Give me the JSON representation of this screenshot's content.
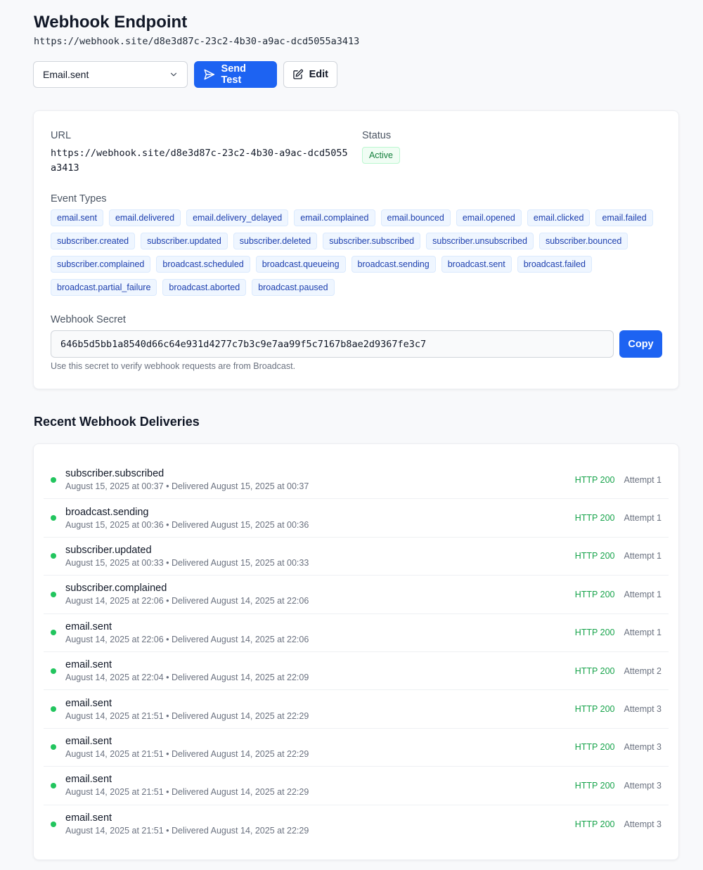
{
  "header": {
    "title": "Webhook Endpoint",
    "url": "https://webhook.site/d8e3d87c-23c2-4b30-a9ac-dcd5055a3413"
  },
  "toolbar": {
    "selected_event": "Email.sent",
    "send_test_label": "Send Test",
    "edit_label": "Edit"
  },
  "details": {
    "url_label": "URL",
    "url_value": "https://webhook.site/d8e3d87c-23c2-4b30-a9ac-dcd5055a3413",
    "status_label": "Status",
    "status_value": "Active",
    "event_types_label": "Event Types",
    "event_types": [
      "email.sent",
      "email.delivered",
      "email.delivery_delayed",
      "email.complained",
      "email.bounced",
      "email.opened",
      "email.clicked",
      "email.failed",
      "subscriber.created",
      "subscriber.updated",
      "subscriber.deleted",
      "subscriber.subscribed",
      "subscriber.unsubscribed",
      "subscriber.bounced",
      "subscriber.complained",
      "broadcast.scheduled",
      "broadcast.queueing",
      "broadcast.sending",
      "broadcast.sent",
      "broadcast.failed",
      "broadcast.partial_failure",
      "broadcast.aborted",
      "broadcast.paused"
    ],
    "secret_label": "Webhook Secret",
    "secret_value": "646b5d5bb1a8540d66c64e931d4277c7b3c9e7aa99f5c7167b8ae2d9367fe3c7",
    "copy_label": "Copy",
    "secret_help": "Use this secret to verify webhook requests are from Broadcast."
  },
  "deliveries": {
    "title": "Recent Webhook Deliveries",
    "items": [
      {
        "event": "subscriber.subscribed",
        "meta": "August 15, 2025 at 00:37 • Delivered August 15, 2025 at 00:37",
        "http": "HTTP 200",
        "attempt": "Attempt 1"
      },
      {
        "event": "broadcast.sending",
        "meta": "August 15, 2025 at 00:36 • Delivered August 15, 2025 at 00:36",
        "http": "HTTP 200",
        "attempt": "Attempt 1"
      },
      {
        "event": "subscriber.updated",
        "meta": "August 15, 2025 at 00:33 • Delivered August 15, 2025 at 00:33",
        "http": "HTTP 200",
        "attempt": "Attempt 1"
      },
      {
        "event": "subscriber.complained",
        "meta": "August 14, 2025 at 22:06 • Delivered August 14, 2025 at 22:06",
        "http": "HTTP 200",
        "attempt": "Attempt 1"
      },
      {
        "event": "email.sent",
        "meta": "August 14, 2025 at 22:06 • Delivered August 14, 2025 at 22:06",
        "http": "HTTP 200",
        "attempt": "Attempt 1"
      },
      {
        "event": "email.sent",
        "meta": "August 14, 2025 at 22:04 • Delivered August 14, 2025 at 22:09",
        "http": "HTTP 200",
        "attempt": "Attempt 2"
      },
      {
        "event": "email.sent",
        "meta": "August 14, 2025 at 21:51 • Delivered August 14, 2025 at 22:29",
        "http": "HTTP 200",
        "attempt": "Attempt 3"
      },
      {
        "event": "email.sent",
        "meta": "August 14, 2025 at 21:51 • Delivered August 14, 2025 at 22:29",
        "http": "HTTP 200",
        "attempt": "Attempt 3"
      },
      {
        "event": "email.sent",
        "meta": "August 14, 2025 at 21:51 • Delivered August 14, 2025 at 22:29",
        "http": "HTTP 200",
        "attempt": "Attempt 3"
      },
      {
        "event": "email.sent",
        "meta": "August 14, 2025 at 21:51 • Delivered August 14, 2025 at 22:29",
        "http": "HTTP 200",
        "attempt": "Attempt 3"
      }
    ]
  },
  "colors": {
    "primary": "#1d63f2",
    "success": "#22c55e",
    "chip_text": "#1e40af"
  }
}
